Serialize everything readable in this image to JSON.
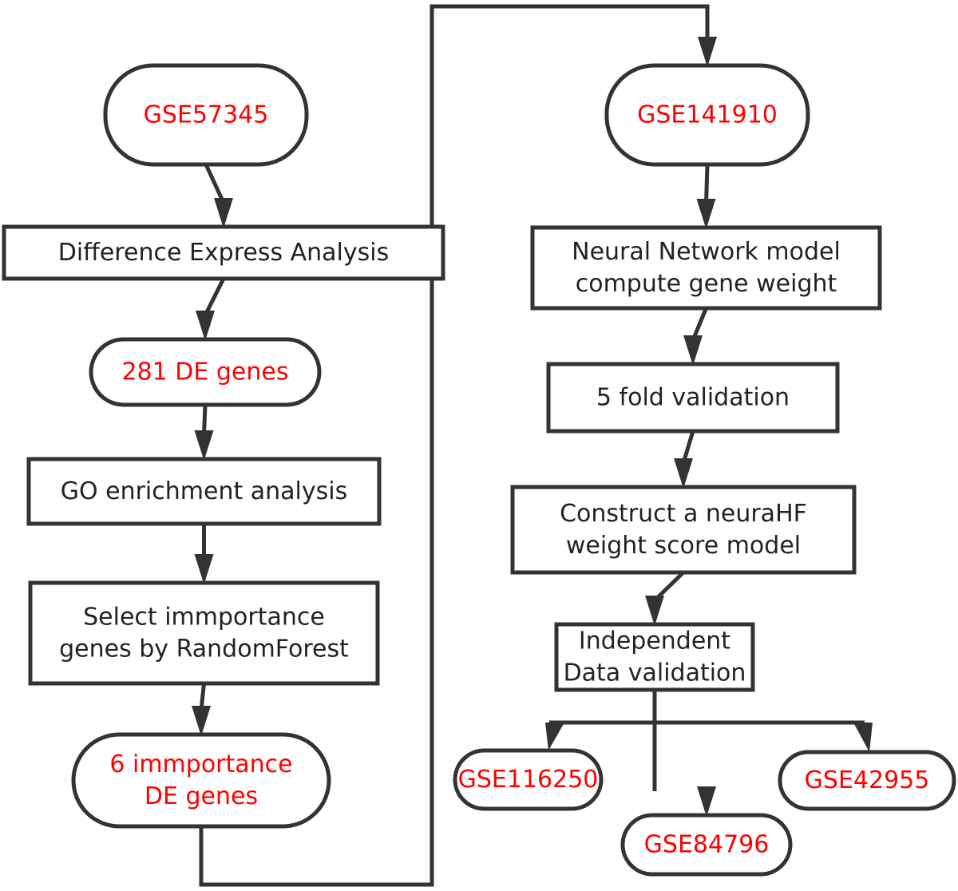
{
  "diagram": {
    "type": "flowchart",
    "colors": {
      "dataset_text": "#ff0000",
      "process_text": "#222222",
      "stroke": "#333333"
    },
    "nodes": [
      {
        "id": "gse57345",
        "shape": "terminal",
        "kind": "dataset",
        "lines": [
          "GSE57345"
        ]
      },
      {
        "id": "diff-express",
        "shape": "process",
        "kind": "step",
        "lines": [
          "Difference Express  Analysis"
        ]
      },
      {
        "id": "de-genes-281",
        "shape": "terminal",
        "kind": "dataset",
        "lines": [
          "281 DE genes"
        ]
      },
      {
        "id": "go-enrichment",
        "shape": "process",
        "kind": "step",
        "lines": [
          "GO enrichment analysis"
        ]
      },
      {
        "id": "select-random-forest",
        "shape": "process",
        "kind": "step",
        "lines": [
          "Select immportance",
          "genes by RandomForest"
        ]
      },
      {
        "id": "importance-genes-6",
        "shape": "terminal",
        "kind": "dataset",
        "lines": [
          "6 immportance",
          "DE genes"
        ]
      },
      {
        "id": "gse141910",
        "shape": "terminal",
        "kind": "dataset",
        "lines": [
          "GSE141910"
        ]
      },
      {
        "id": "neural-network",
        "shape": "process",
        "kind": "step",
        "lines": [
          "Neural Network model",
          "compute gene weight"
        ]
      },
      {
        "id": "five-fold",
        "shape": "process",
        "kind": "step",
        "lines": [
          "5 fold validation"
        ]
      },
      {
        "id": "construct-model",
        "shape": "process",
        "kind": "step",
        "lines": [
          "Construct a neuraHF",
          "weight score model"
        ]
      },
      {
        "id": "independent-validation",
        "shape": "process",
        "kind": "step",
        "lines": [
          "Independent",
          "Data validation"
        ]
      },
      {
        "id": "gse116250",
        "shape": "terminal",
        "kind": "dataset",
        "lines": [
          "GSE116250"
        ]
      },
      {
        "id": "gse84796",
        "shape": "terminal",
        "kind": "dataset",
        "lines": [
          "GSE84796"
        ]
      },
      {
        "id": "gse42955",
        "shape": "terminal",
        "kind": "dataset",
        "lines": [
          "GSE42955"
        ]
      }
    ],
    "edges": [
      {
        "from": "gse57345",
        "to": "diff-express"
      },
      {
        "from": "diff-express",
        "to": "de-genes-281"
      },
      {
        "from": "de-genes-281",
        "to": "go-enrichment"
      },
      {
        "from": "go-enrichment",
        "to": "select-random-forest"
      },
      {
        "from": "select-random-forest",
        "to": "importance-genes-6"
      },
      {
        "from": "importance-genes-6",
        "to": "gse141910"
      },
      {
        "from": "gse141910",
        "to": "neural-network"
      },
      {
        "from": "neural-network",
        "to": "five-fold"
      },
      {
        "from": "five-fold",
        "to": "construct-model"
      },
      {
        "from": "construct-model",
        "to": "independent-validation"
      },
      {
        "from": "independent-validation",
        "to": "gse116250"
      },
      {
        "from": "independent-validation",
        "to": "gse84796"
      },
      {
        "from": "independent-validation",
        "to": "gse42955"
      }
    ]
  }
}
